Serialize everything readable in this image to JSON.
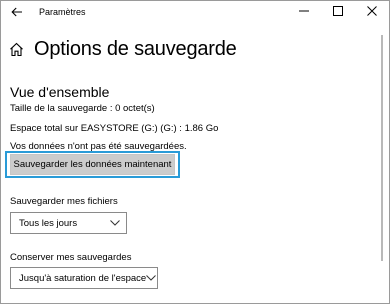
{
  "window": {
    "app_title": "Paramètres"
  },
  "header": {
    "page_title": "Options de sauvegarde"
  },
  "overview": {
    "section_title": "Vue d'ensemble",
    "backup_size": "Taille de la sauvegarde : 0 octet(s)",
    "total_space": "Espace total sur EASYSTORE (G:) (G:) : 1.86 Go",
    "status": "Vos données n'ont pas été sauvegardées.",
    "backup_now_label": "Sauvegarder les données maintenant"
  },
  "frequency": {
    "label": "Sauvegarder mes fichiers",
    "selected": "Tous les jours"
  },
  "retention": {
    "label": "Conserver mes sauvegardes",
    "selected": "Jusqu'à saturation de l'espace"
  },
  "colors": {
    "focus_outline": "#2a9bd7",
    "button_background": "#cccccc",
    "dropdown_border": "#8a8a8a"
  },
  "icons": {
    "back": "back-arrow-icon",
    "home": "home-icon",
    "minimize": "minimize-icon",
    "maximize": "maximize-icon",
    "close": "close-icon",
    "dropdown": "chevron-down-icon"
  }
}
